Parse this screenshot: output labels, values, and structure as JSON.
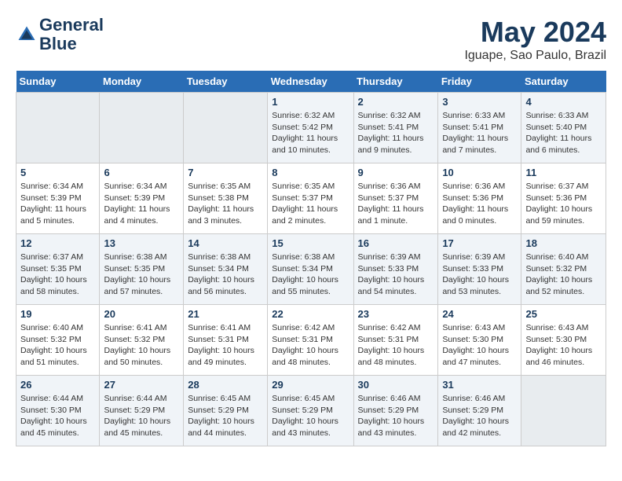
{
  "logo": {
    "line1": "General",
    "line2": "Blue"
  },
  "title": "May 2024",
  "subtitle": "Iguape, Sao Paulo, Brazil",
  "days_of_week": [
    "Sunday",
    "Monday",
    "Tuesday",
    "Wednesday",
    "Thursday",
    "Friday",
    "Saturday"
  ],
  "weeks": [
    [
      {
        "day": "",
        "info": ""
      },
      {
        "day": "",
        "info": ""
      },
      {
        "day": "",
        "info": ""
      },
      {
        "day": "1",
        "info": "Sunrise: 6:32 AM\nSunset: 5:42 PM\nDaylight: 11 hours and 10 minutes."
      },
      {
        "day": "2",
        "info": "Sunrise: 6:32 AM\nSunset: 5:41 PM\nDaylight: 11 hours and 9 minutes."
      },
      {
        "day": "3",
        "info": "Sunrise: 6:33 AM\nSunset: 5:41 PM\nDaylight: 11 hours and 7 minutes."
      },
      {
        "day": "4",
        "info": "Sunrise: 6:33 AM\nSunset: 5:40 PM\nDaylight: 11 hours and 6 minutes."
      }
    ],
    [
      {
        "day": "5",
        "info": "Sunrise: 6:34 AM\nSunset: 5:39 PM\nDaylight: 11 hours and 5 minutes."
      },
      {
        "day": "6",
        "info": "Sunrise: 6:34 AM\nSunset: 5:39 PM\nDaylight: 11 hours and 4 minutes."
      },
      {
        "day": "7",
        "info": "Sunrise: 6:35 AM\nSunset: 5:38 PM\nDaylight: 11 hours and 3 minutes."
      },
      {
        "day": "8",
        "info": "Sunrise: 6:35 AM\nSunset: 5:37 PM\nDaylight: 11 hours and 2 minutes."
      },
      {
        "day": "9",
        "info": "Sunrise: 6:36 AM\nSunset: 5:37 PM\nDaylight: 11 hours and 1 minute."
      },
      {
        "day": "10",
        "info": "Sunrise: 6:36 AM\nSunset: 5:36 PM\nDaylight: 11 hours and 0 minutes."
      },
      {
        "day": "11",
        "info": "Sunrise: 6:37 AM\nSunset: 5:36 PM\nDaylight: 10 hours and 59 minutes."
      }
    ],
    [
      {
        "day": "12",
        "info": "Sunrise: 6:37 AM\nSunset: 5:35 PM\nDaylight: 10 hours and 58 minutes."
      },
      {
        "day": "13",
        "info": "Sunrise: 6:38 AM\nSunset: 5:35 PM\nDaylight: 10 hours and 57 minutes."
      },
      {
        "day": "14",
        "info": "Sunrise: 6:38 AM\nSunset: 5:34 PM\nDaylight: 10 hours and 56 minutes."
      },
      {
        "day": "15",
        "info": "Sunrise: 6:38 AM\nSunset: 5:34 PM\nDaylight: 10 hours and 55 minutes."
      },
      {
        "day": "16",
        "info": "Sunrise: 6:39 AM\nSunset: 5:33 PM\nDaylight: 10 hours and 54 minutes."
      },
      {
        "day": "17",
        "info": "Sunrise: 6:39 AM\nSunset: 5:33 PM\nDaylight: 10 hours and 53 minutes."
      },
      {
        "day": "18",
        "info": "Sunrise: 6:40 AM\nSunset: 5:32 PM\nDaylight: 10 hours and 52 minutes."
      }
    ],
    [
      {
        "day": "19",
        "info": "Sunrise: 6:40 AM\nSunset: 5:32 PM\nDaylight: 10 hours and 51 minutes."
      },
      {
        "day": "20",
        "info": "Sunrise: 6:41 AM\nSunset: 5:32 PM\nDaylight: 10 hours and 50 minutes."
      },
      {
        "day": "21",
        "info": "Sunrise: 6:41 AM\nSunset: 5:31 PM\nDaylight: 10 hours and 49 minutes."
      },
      {
        "day": "22",
        "info": "Sunrise: 6:42 AM\nSunset: 5:31 PM\nDaylight: 10 hours and 48 minutes."
      },
      {
        "day": "23",
        "info": "Sunrise: 6:42 AM\nSunset: 5:31 PM\nDaylight: 10 hours and 48 minutes."
      },
      {
        "day": "24",
        "info": "Sunrise: 6:43 AM\nSunset: 5:30 PM\nDaylight: 10 hours and 47 minutes."
      },
      {
        "day": "25",
        "info": "Sunrise: 6:43 AM\nSunset: 5:30 PM\nDaylight: 10 hours and 46 minutes."
      }
    ],
    [
      {
        "day": "26",
        "info": "Sunrise: 6:44 AM\nSunset: 5:30 PM\nDaylight: 10 hours and 45 minutes."
      },
      {
        "day": "27",
        "info": "Sunrise: 6:44 AM\nSunset: 5:29 PM\nDaylight: 10 hours and 45 minutes."
      },
      {
        "day": "28",
        "info": "Sunrise: 6:45 AM\nSunset: 5:29 PM\nDaylight: 10 hours and 44 minutes."
      },
      {
        "day": "29",
        "info": "Sunrise: 6:45 AM\nSunset: 5:29 PM\nDaylight: 10 hours and 43 minutes."
      },
      {
        "day": "30",
        "info": "Sunrise: 6:46 AM\nSunset: 5:29 PM\nDaylight: 10 hours and 43 minutes."
      },
      {
        "day": "31",
        "info": "Sunrise: 6:46 AM\nSunset: 5:29 PM\nDaylight: 10 hours and 42 minutes."
      },
      {
        "day": "",
        "info": ""
      }
    ]
  ]
}
